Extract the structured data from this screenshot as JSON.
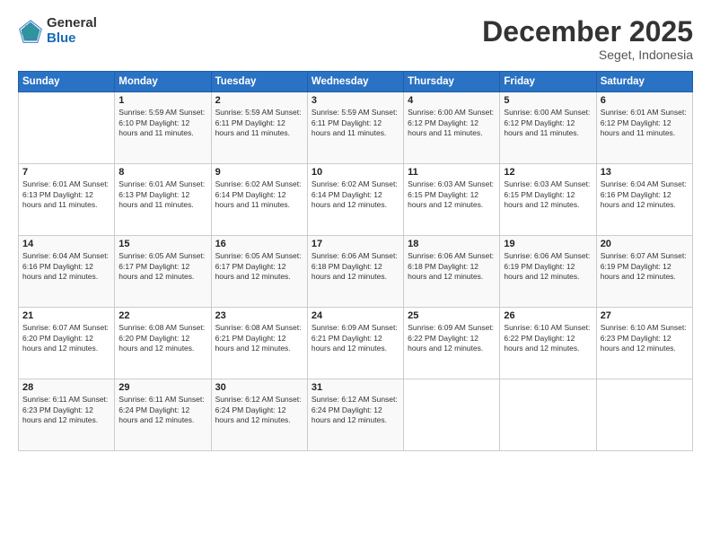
{
  "logo": {
    "general": "General",
    "blue": "Blue"
  },
  "header": {
    "month": "December 2025",
    "location": "Seget, Indonesia"
  },
  "days_of_week": [
    "Sunday",
    "Monday",
    "Tuesday",
    "Wednesday",
    "Thursday",
    "Friday",
    "Saturday"
  ],
  "weeks": [
    [
      {
        "day": "",
        "info": ""
      },
      {
        "day": "1",
        "info": "Sunrise: 5:59 AM\nSunset: 6:10 PM\nDaylight: 12 hours\nand 11 minutes."
      },
      {
        "day": "2",
        "info": "Sunrise: 5:59 AM\nSunset: 6:11 PM\nDaylight: 12 hours\nand 11 minutes."
      },
      {
        "day": "3",
        "info": "Sunrise: 5:59 AM\nSunset: 6:11 PM\nDaylight: 12 hours\nand 11 minutes."
      },
      {
        "day": "4",
        "info": "Sunrise: 6:00 AM\nSunset: 6:12 PM\nDaylight: 12 hours\nand 11 minutes."
      },
      {
        "day": "5",
        "info": "Sunrise: 6:00 AM\nSunset: 6:12 PM\nDaylight: 12 hours\nand 11 minutes."
      },
      {
        "day": "6",
        "info": "Sunrise: 6:01 AM\nSunset: 6:12 PM\nDaylight: 12 hours\nand 11 minutes."
      }
    ],
    [
      {
        "day": "7",
        "info": "Sunrise: 6:01 AM\nSunset: 6:13 PM\nDaylight: 12 hours\nand 11 minutes."
      },
      {
        "day": "8",
        "info": "Sunrise: 6:01 AM\nSunset: 6:13 PM\nDaylight: 12 hours\nand 11 minutes."
      },
      {
        "day": "9",
        "info": "Sunrise: 6:02 AM\nSunset: 6:14 PM\nDaylight: 12 hours\nand 11 minutes."
      },
      {
        "day": "10",
        "info": "Sunrise: 6:02 AM\nSunset: 6:14 PM\nDaylight: 12 hours\nand 12 minutes."
      },
      {
        "day": "11",
        "info": "Sunrise: 6:03 AM\nSunset: 6:15 PM\nDaylight: 12 hours\nand 12 minutes."
      },
      {
        "day": "12",
        "info": "Sunrise: 6:03 AM\nSunset: 6:15 PM\nDaylight: 12 hours\nand 12 minutes."
      },
      {
        "day": "13",
        "info": "Sunrise: 6:04 AM\nSunset: 6:16 PM\nDaylight: 12 hours\nand 12 minutes."
      }
    ],
    [
      {
        "day": "14",
        "info": "Sunrise: 6:04 AM\nSunset: 6:16 PM\nDaylight: 12 hours\nand 12 minutes."
      },
      {
        "day": "15",
        "info": "Sunrise: 6:05 AM\nSunset: 6:17 PM\nDaylight: 12 hours\nand 12 minutes."
      },
      {
        "day": "16",
        "info": "Sunrise: 6:05 AM\nSunset: 6:17 PM\nDaylight: 12 hours\nand 12 minutes."
      },
      {
        "day": "17",
        "info": "Sunrise: 6:06 AM\nSunset: 6:18 PM\nDaylight: 12 hours\nand 12 minutes."
      },
      {
        "day": "18",
        "info": "Sunrise: 6:06 AM\nSunset: 6:18 PM\nDaylight: 12 hours\nand 12 minutes."
      },
      {
        "day": "19",
        "info": "Sunrise: 6:06 AM\nSunset: 6:19 PM\nDaylight: 12 hours\nand 12 minutes."
      },
      {
        "day": "20",
        "info": "Sunrise: 6:07 AM\nSunset: 6:19 PM\nDaylight: 12 hours\nand 12 minutes."
      }
    ],
    [
      {
        "day": "21",
        "info": "Sunrise: 6:07 AM\nSunset: 6:20 PM\nDaylight: 12 hours\nand 12 minutes."
      },
      {
        "day": "22",
        "info": "Sunrise: 6:08 AM\nSunset: 6:20 PM\nDaylight: 12 hours\nand 12 minutes."
      },
      {
        "day": "23",
        "info": "Sunrise: 6:08 AM\nSunset: 6:21 PM\nDaylight: 12 hours\nand 12 minutes."
      },
      {
        "day": "24",
        "info": "Sunrise: 6:09 AM\nSunset: 6:21 PM\nDaylight: 12 hours\nand 12 minutes."
      },
      {
        "day": "25",
        "info": "Sunrise: 6:09 AM\nSunset: 6:22 PM\nDaylight: 12 hours\nand 12 minutes."
      },
      {
        "day": "26",
        "info": "Sunrise: 6:10 AM\nSunset: 6:22 PM\nDaylight: 12 hours\nand 12 minutes."
      },
      {
        "day": "27",
        "info": "Sunrise: 6:10 AM\nSunset: 6:23 PM\nDaylight: 12 hours\nand 12 minutes."
      }
    ],
    [
      {
        "day": "28",
        "info": "Sunrise: 6:11 AM\nSunset: 6:23 PM\nDaylight: 12 hours\nand 12 minutes."
      },
      {
        "day": "29",
        "info": "Sunrise: 6:11 AM\nSunset: 6:24 PM\nDaylight: 12 hours\nand 12 minutes."
      },
      {
        "day": "30",
        "info": "Sunrise: 6:12 AM\nSunset: 6:24 PM\nDaylight: 12 hours\nand 12 minutes."
      },
      {
        "day": "31",
        "info": "Sunrise: 6:12 AM\nSunset: 6:24 PM\nDaylight: 12 hours\nand 12 minutes."
      },
      {
        "day": "",
        "info": ""
      },
      {
        "day": "",
        "info": ""
      },
      {
        "day": "",
        "info": ""
      }
    ]
  ]
}
